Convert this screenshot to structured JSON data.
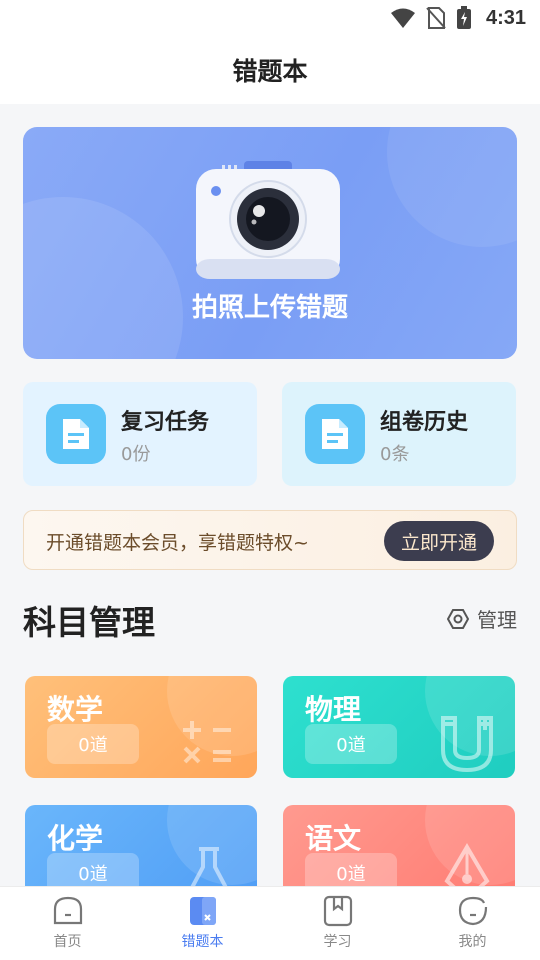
{
  "status_bar": {
    "time": "4:31"
  },
  "header": {
    "title": "错题本"
  },
  "hero": {
    "label": "拍照上传错题"
  },
  "quick_cards": [
    {
      "title": "复习任务",
      "sub": "0份",
      "bg": "#e3f3ff"
    },
    {
      "title": "组卷历史",
      "sub": "0条",
      "bg": "#ddf3fc"
    }
  ],
  "vip": {
    "text": "开通错题本会员，享错题特权~",
    "button": "立即开通"
  },
  "subjects_section": {
    "title": "科目管理",
    "manage_label": "管理"
  },
  "subjects": [
    {
      "name": "数学",
      "count": "0道",
      "color": "#ffb26b",
      "icon": "calculator-icon"
    },
    {
      "name": "物理",
      "count": "0道",
      "color": "#22d3c6",
      "icon": "magnet-icon"
    },
    {
      "name": "化学",
      "count": "0道",
      "color": "#5aa8f8",
      "icon": "flask-icon"
    },
    {
      "name": "语文",
      "count": "0道",
      "color": "#ff8a80",
      "icon": "pen-nib-icon"
    }
  ],
  "tab_bar": {
    "tabs": [
      {
        "label": "首页",
        "icon": "home-icon"
      },
      {
        "label": "错题本",
        "icon": "notebook-icon",
        "active": true
      },
      {
        "label": "学习",
        "icon": "book-icon"
      },
      {
        "label": "我的",
        "icon": "profile-icon"
      }
    ]
  },
  "colors": {
    "accent": "#4a7cf0",
    "hero": "#7a9ef5"
  }
}
